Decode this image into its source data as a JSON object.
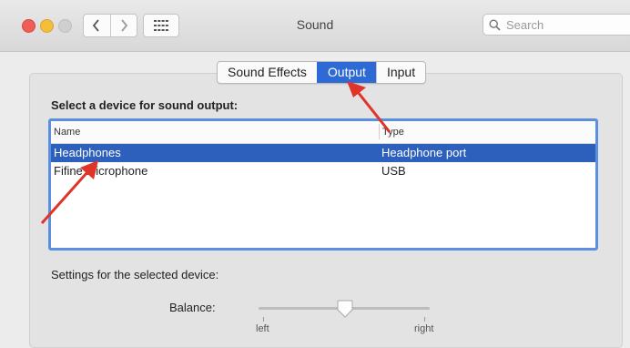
{
  "window": {
    "title": "Sound",
    "search_placeholder": "Search",
    "icons": {
      "back": "chevron-left-icon",
      "forward": "chevron-right-icon",
      "grid": "grid-icon",
      "search": "search-icon"
    }
  },
  "tabs": [
    {
      "label": "Sound Effects",
      "active": false
    },
    {
      "label": "Output",
      "active": true
    },
    {
      "label": "Input",
      "active": false
    }
  ],
  "output": {
    "section_title": "Select a device for sound output:",
    "columns": {
      "name": "Name",
      "type": "Type"
    },
    "devices": [
      {
        "name": "Headphones",
        "type": "Headphone port",
        "selected": true
      },
      {
        "name": "Fifine Microphone",
        "type": "USB",
        "selected": false
      }
    ],
    "settings_label": "Settings for the selected device:",
    "balance": {
      "label": "Balance:",
      "left_label": "left",
      "right_label": "right",
      "value": 0.5
    }
  },
  "colors": {
    "accent": "#2d6ad6",
    "selection": "#2d5fbc",
    "annotation_arrow": "#e0332a"
  }
}
